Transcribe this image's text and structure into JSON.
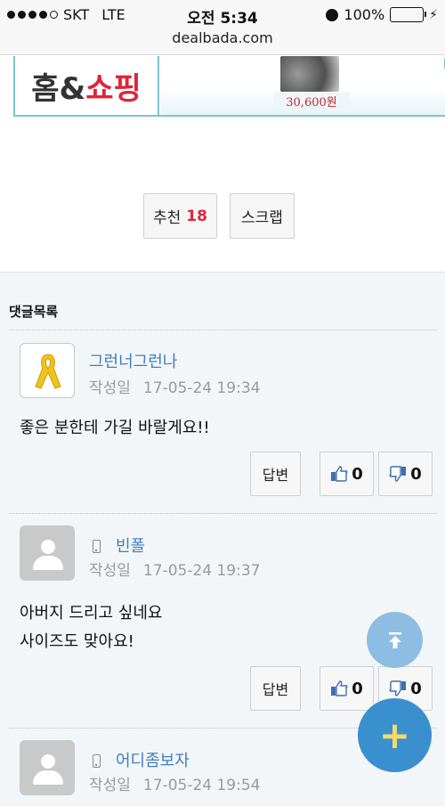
{
  "status_bar": {
    "carrier": "SKT",
    "network": "LTE",
    "time": "오전 5:34",
    "battery": "100%",
    "battery_level": 1.0,
    "url": "dealbada.com"
  },
  "ad": {
    "logo_part1": "홈&",
    "logo_part2": "쇼핑",
    "price": "30,600원"
  },
  "actions": {
    "recommend_label": "추천",
    "recommend_count": "18",
    "scrap_label": "스크랩"
  },
  "comments": {
    "title": "댓글목록",
    "written_label": "작성일",
    "reply_label": "답변",
    "items": [
      {
        "author": "그런너그런나",
        "date": "17-05-24 19:34",
        "lines": [
          "좋은 분한테 가길 바랄게요!!"
        ],
        "likes": "0",
        "dislikes": "0"
      },
      {
        "author": "빈폴",
        "date": "17-05-24 19:37",
        "lines": [
          "아버지 드리고 싶네요",
          "사이즈도 맞아요!"
        ],
        "likes": "0",
        "dislikes": "0"
      },
      {
        "author": "어디좀보자",
        "date": "17-05-24 19:54"
      }
    ]
  },
  "colors": {
    "link": "#3f7fbf",
    "count_accent": "#e0243a",
    "fab": "#3a8fcf",
    "fab_top": "#8dbde3"
  }
}
